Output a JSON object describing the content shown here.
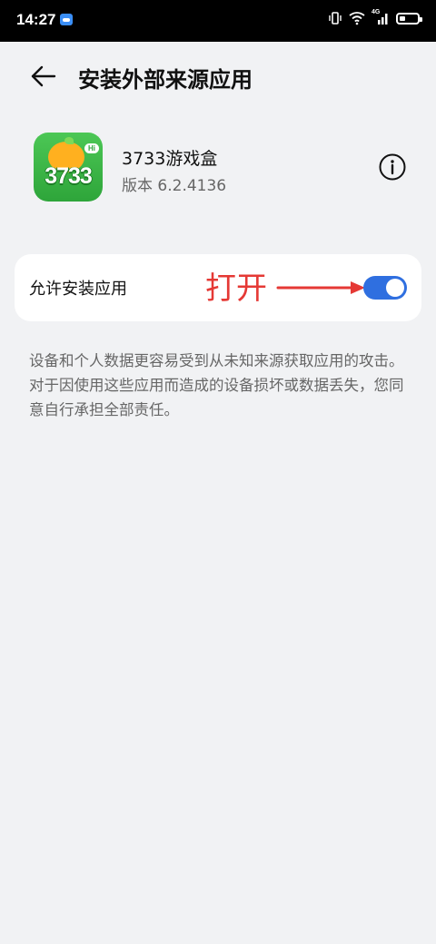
{
  "status_bar": {
    "time": "14:27",
    "signal_label": "4G"
  },
  "header": {
    "title": "安装外部来源应用"
  },
  "app": {
    "name": "3733游戏盒",
    "version": "版本 6.2.4136",
    "icon_text": "3733",
    "icon_badge": "Hi"
  },
  "setting": {
    "label": "允许安装应用",
    "annotation": "打开",
    "enabled": true
  },
  "description": "设备和个人数据更容易受到从未知来源获取应用的攻击。对于因使用这些应用而造成的设备损坏或数据丢失，您同意自行承担全部责任。",
  "colors": {
    "toggle_on": "#2f6fe0",
    "annotation": "#e53935",
    "background": "#f1f2f4"
  }
}
